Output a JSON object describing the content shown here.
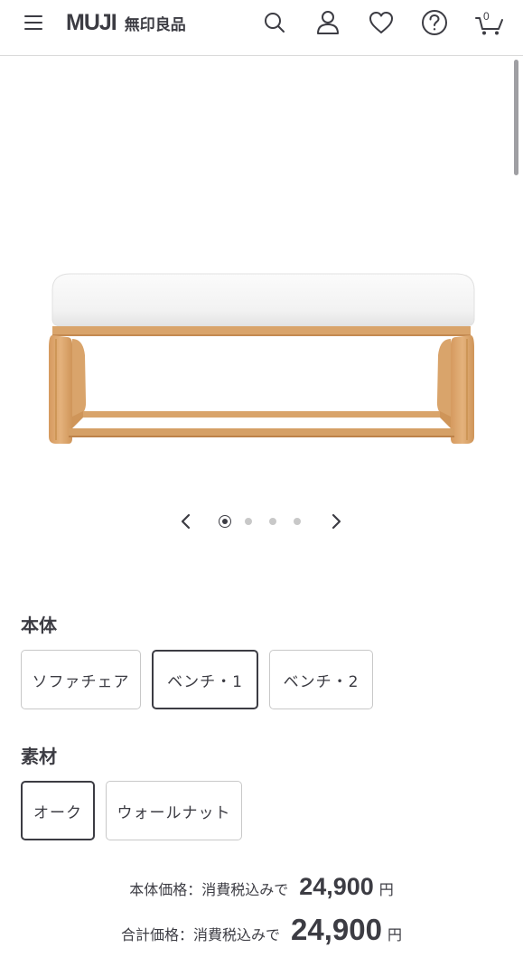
{
  "header": {
    "logo_en": "MUJI",
    "logo_jp": "無印良品",
    "cart_count": "0"
  },
  "carousel": {
    "slide_count": 4,
    "active_index": 0
  },
  "options": {
    "body": {
      "title": "本体",
      "items": [
        "ソファチェア",
        "ベンチ・1",
        "ベンチ・2"
      ],
      "selected": "ベンチ・1"
    },
    "material": {
      "title": "素材",
      "items": [
        "オーク",
        "ウォールナット"
      ],
      "selected": "オーク"
    }
  },
  "price": {
    "body_label": "本体価格：消費税込みで",
    "body_value": "24,900",
    "total_label": "合計価格：消費税込みで",
    "total_value": "24,900",
    "unit": "円"
  },
  "colors": {
    "text": "#3c3c43",
    "border": "#c8c8c8",
    "wood": "#d9a46b",
    "cushion": "#f4f4f4"
  }
}
